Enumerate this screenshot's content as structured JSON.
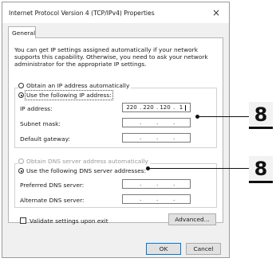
{
  "dialog": {
    "title": "Internet Protocol Version 4 (TCP/IPv4) Properties",
    "close_glyph": "×",
    "tab_label": "General",
    "description": "You can get IP settings assigned automatically if your network supports this capability. Otherwise, you need to ask your network administrator for the appropriate IP settings."
  },
  "ip_section": {
    "auto_label": "Obtain an IP address automatically",
    "manual_label": "Use the following IP address:",
    "selected": "manual",
    "fields": [
      {
        "label": "IP address:",
        "octets": [
          "220",
          "220",
          "120",
          "1"
        ]
      },
      {
        "label": "Subnet mask:",
        "octets": [
          "",
          "",
          "",
          ""
        ]
      },
      {
        "label": "Default gateway:",
        "octets": [
          "",
          "",
          "",
          ""
        ]
      }
    ]
  },
  "dns_section": {
    "auto_label": "Obtain DNS server address automatically",
    "manual_label": "Use the following DNS server addresses:",
    "selected": "manual",
    "fields": [
      {
        "label": "Preferred DNS server:",
        "octets": [
          "",
          "",
          "",
          ""
        ]
      },
      {
        "label": "Alternate DNS server:",
        "octets": [
          "",
          "",
          "",
          ""
        ]
      }
    ]
  },
  "validate_label": "Validate settings upon exit",
  "validate_checked": false,
  "buttons": {
    "advanced": "Advanced...",
    "ok": "OK",
    "cancel": "Cancel"
  },
  "callouts": [
    "8",
    "8"
  ]
}
